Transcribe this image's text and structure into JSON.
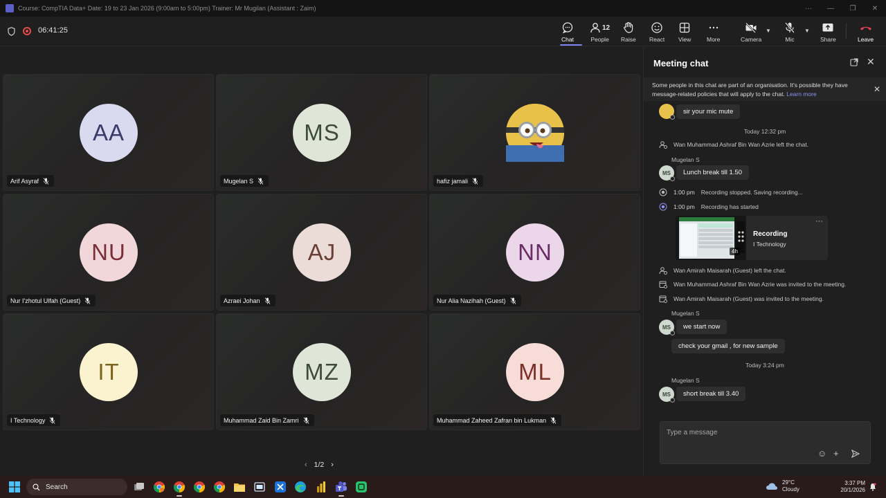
{
  "window": {
    "title": "Course: CompTIA Data+ Date: 19 to 23 Jan 2026 (9:00am to 5:00pm) Trainer: Mr Mugilan (Assistant : Zaim)",
    "controls": [
      "···",
      "—",
      "❐",
      "✕"
    ]
  },
  "toolbar": {
    "timer": "06:41:25",
    "chat_label": "Chat",
    "people_label": "People",
    "people_count": "12",
    "raise_label": "Raise",
    "react_label": "React",
    "view_label": "View",
    "more_label": "More",
    "camera_label": "Camera",
    "mic_label": "Mic",
    "share_label": "Share",
    "leave_label": "Leave",
    "accent_color": "#7f85f5",
    "leave_color": "#c4314b"
  },
  "participants": [
    {
      "initials": "AA",
      "name": "Arif Asyraf",
      "bg": "#d9d9f0",
      "fg": "#3b3b6b"
    },
    {
      "initials": "MS",
      "name": "Mugelan S",
      "bg": "#dfe6d8",
      "fg": "#3c4c36"
    },
    {
      "initials": "",
      "name": "hafiz jamali",
      "bg": "#e8c14a",
      "fg": "#222222"
    },
    {
      "initials": "NU",
      "name": "Nur I'zhotul Ulfah (Guest)",
      "bg": "#f2d7da",
      "fg": "#7a2e38"
    },
    {
      "initials": "AJ",
      "name": "Azraei Johan",
      "bg": "#ecdcd8",
      "fg": "#6a3f36"
    },
    {
      "initials": "NN",
      "name": "Nur Alia Nazihah (Guest)",
      "bg": "#ecd7ea",
      "fg": "#6b2d68"
    },
    {
      "initials": "IT",
      "name": "I Technology",
      "bg": "#fbf3cf",
      "fg": "#7a6420"
    },
    {
      "initials": "MZ",
      "name": "Muhammad Zaid Bin Zamri",
      "bg": "#dfe6d8",
      "fg": "#3c4c36"
    },
    {
      "initials": "ML",
      "name": "Muhammad Zaheed Zafran bin Lukman",
      "bg": "#f7dcd8",
      "fg": "#7a3128"
    }
  ],
  "pager": {
    "text": "1/2"
  },
  "chat": {
    "title": "Meeting chat",
    "banner_text": "Some people in this chat are part of an organisation. It's possible they have message-related policies that will apply to the chat.",
    "banner_link": "Learn more",
    "msg_top": "sir your mic mute",
    "day1": "Today 12:32 pm",
    "event_left_1": "Wan Muhammad Ashraf Bin Wan Azrie left the chat.",
    "sender_1": "Mugelan S",
    "msg_lunch": "Lunch break till 1.50",
    "rec_stop_time": "1:00 pm",
    "rec_stop_text": "Recording stopped. Saving recording...",
    "rec_start_time": "1:00 pm",
    "rec_start_text": "Recording has started",
    "rec_title": "Recording",
    "rec_sub": "I Technology",
    "rec_duration": "4h",
    "event_left_2": "Wan Amirah Maisarah (Guest) left the chat.",
    "event_invited_1": "Wan Muhammad Ashraf Bin Wan Azrie was invited to the meeting.",
    "event_invited_2": "Wan Amirah Maisarah (Guest) was invited to the meeting.",
    "sender_2": "Mugelan S",
    "msg_start": "we start now",
    "msg_gmail": "check your gmail , for new sample",
    "day2": "Today 3:24 pm",
    "sender_3": "Mugelan S",
    "msg_short": "short break till 3.40",
    "avatar_initials": "MS",
    "compose_placeholder": "Type a message"
  },
  "taskbar": {
    "search_label": "Search",
    "weather_temp": "29°C",
    "weather_desc": "Cloudy",
    "time": "3:37 PM",
    "date": "20/1/2026"
  }
}
